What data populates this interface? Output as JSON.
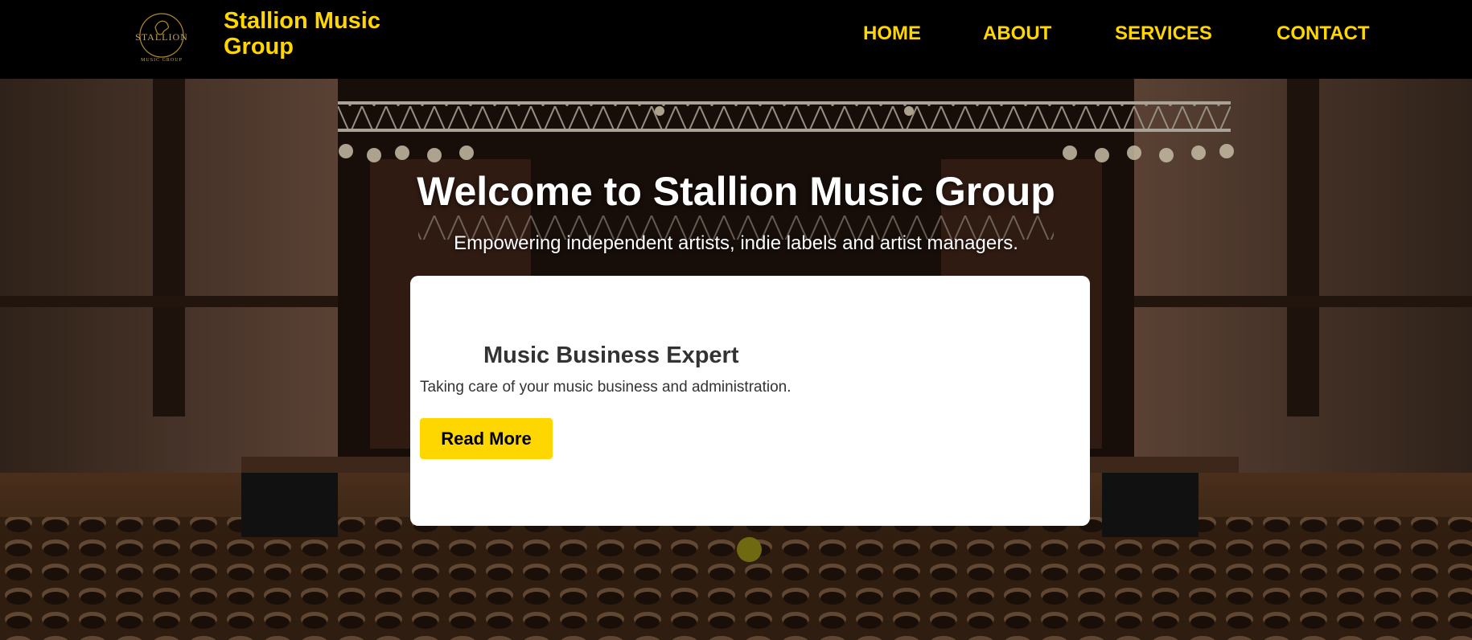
{
  "header": {
    "brand": "Stallion Music Group",
    "logo": {
      "word": "STALLION",
      "tagline": "MUSIC GROUP",
      "icon": "horse-head-emblem"
    },
    "nav": {
      "home": "HOME",
      "about": "ABOUT",
      "services": "SERVICES",
      "contact": "CONTACT"
    }
  },
  "hero": {
    "title": "Welcome to Stallion Music Group",
    "subtitle": "Empowering independent artists, indie labels and artist managers.",
    "background": "concert-hall-stage-photo"
  },
  "card": {
    "title": "Music Business Expert",
    "text": "Taking care of your music business and administration.",
    "button": "Read More"
  },
  "carousel": {
    "active_index": 1,
    "count": 1
  },
  "colors": {
    "accent": "#FFD700",
    "header_bg": "#000000",
    "card_bg": "#FFFFFF",
    "dot": "#6F6A12"
  }
}
